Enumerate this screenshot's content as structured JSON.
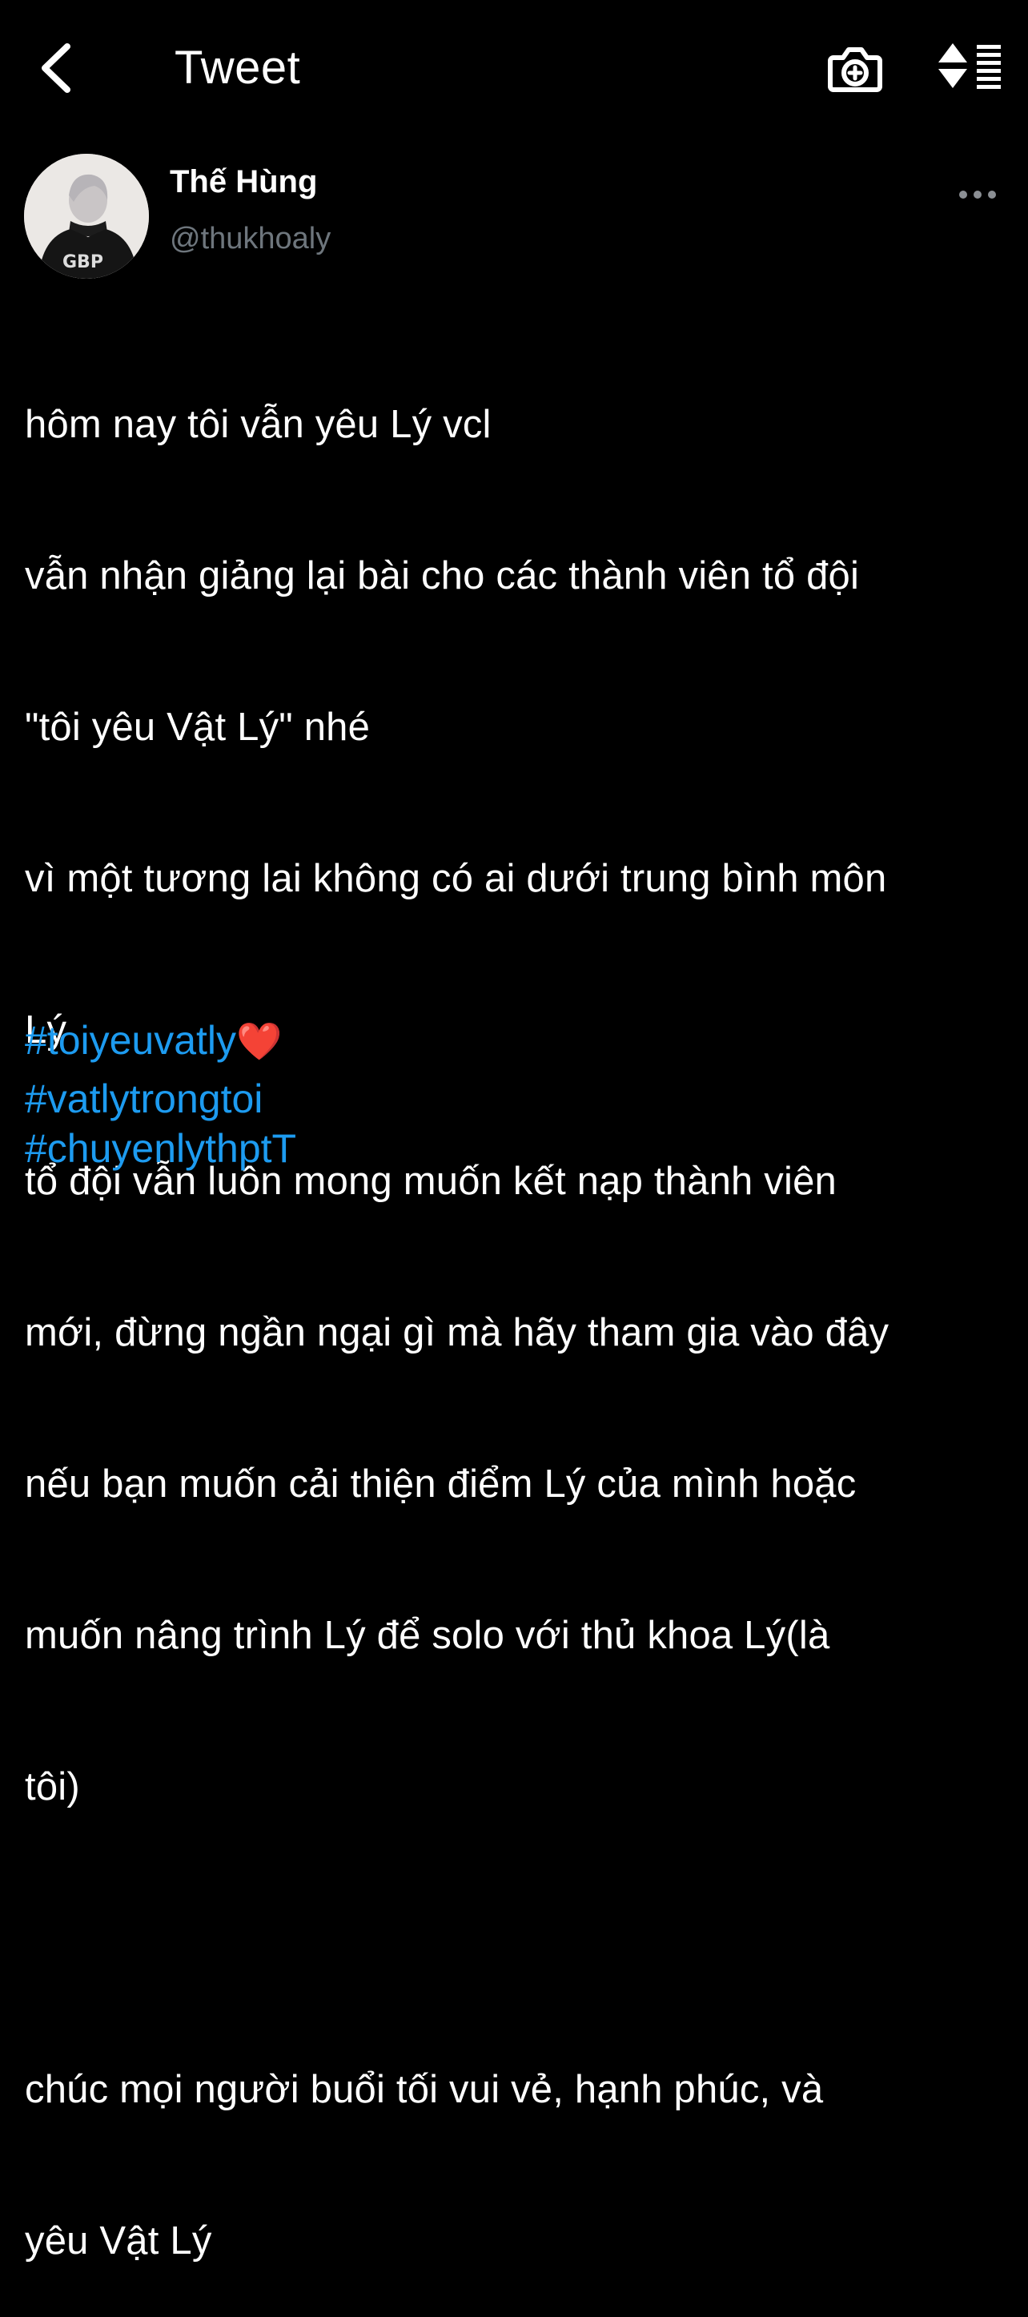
{
  "header": {
    "title": "Tweet",
    "back_icon": "chevron-left-icon",
    "camera_icon": "camera-add-icon",
    "sort_icon": "sort-list-icon"
  },
  "tweet": {
    "author_name": "Thế Hùng",
    "author_handle": "@thukhoaly",
    "more_icon": "more-horizontal-icon",
    "body_lines": [
      "hôm nay tôi vẫn yêu Lý vcl",
      "vẫn nhận giảng lại bài cho các thành viên tổ đội",
      "\"tôi yêu Vật Lý\" nhé",
      "vì một tương lai không có ai dưới trung bình môn",
      "Lý",
      "tổ đội vẫn luôn mong muốn kết nạp thành viên",
      "mới, đừng ngần ngại gì mà hãy tham gia vào đây",
      "nếu bạn muốn cải thiện điểm Lý của mình hoặc",
      "muốn nâng trình Lý để solo với thủ khoa Lý(là",
      "tôi)",
      "",
      "chúc mọi người buổi tối vui vẻ, hạnh phúc, và",
      "yêu Vật Lý"
    ],
    "hashtags": [
      "#toiyeuvatly",
      "#vatlytrongtoi",
      "#chuyenlythptT"
    ],
    "heart_emoji": "❤️"
  },
  "colors": {
    "background": "#000000",
    "text": "#ffffff",
    "handle": "#6e767d",
    "link": "#1d9bf0"
  }
}
